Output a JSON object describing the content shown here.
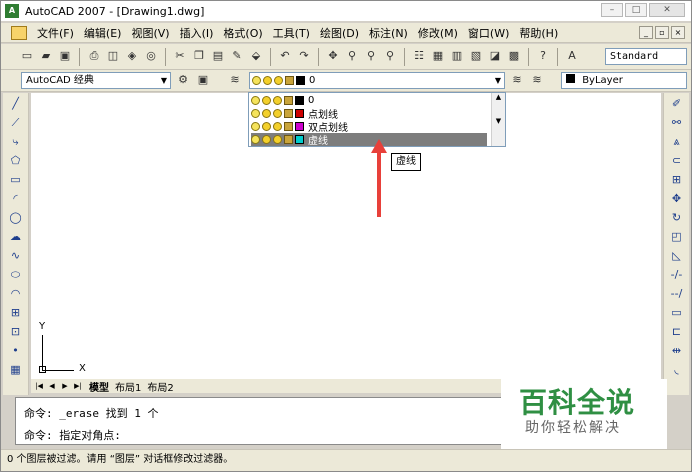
{
  "window": {
    "title": "AutoCAD 2007 - [Drawing1.dwg]",
    "app_icon": "AutoCAD"
  },
  "menu": {
    "items": [
      "文件(F)",
      "编辑(E)",
      "视图(V)",
      "插入(I)",
      "格式(O)",
      "工具(T)",
      "绘图(D)",
      "标注(N)",
      "修改(M)",
      "窗口(W)",
      "帮助(H)"
    ]
  },
  "toolbars": {
    "text_style": "Standard",
    "workspace": "AutoCAD 经典",
    "current_layer": "0",
    "color": "ByLayer"
  },
  "layer_dropdown": {
    "rows": [
      {
        "name": "0",
        "color": "#000000"
      },
      {
        "name": "点划线",
        "color": "#cc0000"
      },
      {
        "name": "双点划线",
        "color": "#cc00cc"
      },
      {
        "name": "虚线",
        "color": "#00cccc"
      }
    ],
    "selected": "虚线"
  },
  "tooltip": {
    "text": "虚线"
  },
  "ucs": {
    "x": "X",
    "y": "Y"
  },
  "layout_tabs": [
    "模型",
    "布局1",
    "布局2"
  ],
  "command": {
    "lines": [
      "命令: _erase 找到 1 个",
      "命令: 指定对角点:"
    ]
  },
  "status": {
    "text": "0 个图层被过滤。请用 “图层” 对话框修改过滤器。"
  },
  "watermark": {
    "title": "百科全说",
    "subtitle": "助你轻松解决"
  },
  "colors": {
    "accent": "#e8403a",
    "watermark": "#2f8f43",
    "selection": "#7d7d7d"
  }
}
